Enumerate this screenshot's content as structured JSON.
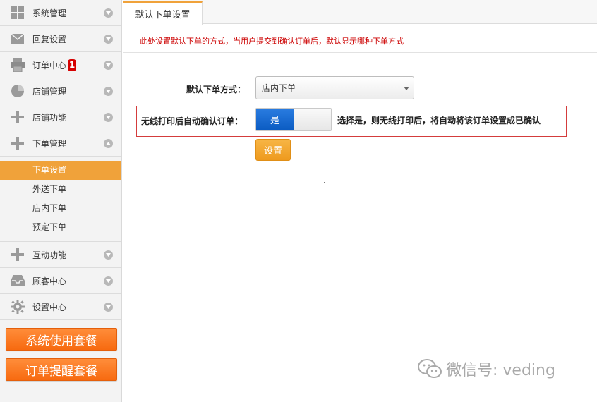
{
  "sidebar": {
    "items": [
      {
        "label": "系统管理",
        "icon": "grid-icon"
      },
      {
        "label": "回复设置",
        "icon": "envelope-icon"
      },
      {
        "label": "订单中心",
        "icon": "printer-icon",
        "badge": "1"
      },
      {
        "label": "店铺管理",
        "icon": "pie-chart-icon"
      },
      {
        "label": "店铺功能",
        "icon": "plus-icon"
      },
      {
        "label": "下单管理",
        "icon": "plus-icon",
        "expanded": true
      }
    ],
    "submenu": [
      {
        "label": "下单设置",
        "active": true
      },
      {
        "label": "外送下单"
      },
      {
        "label": "店内下单"
      },
      {
        "label": "预定下单"
      }
    ],
    "items_after": [
      {
        "label": "互动功能",
        "icon": "plus-icon"
      },
      {
        "label": "顾客中心",
        "icon": "inbox-icon"
      },
      {
        "label": "设置中心",
        "icon": "gear-icon"
      }
    ],
    "buttons": {
      "system_plan": "系统使用套餐",
      "order_alert_plan": "订单提醒套餐"
    }
  },
  "main": {
    "tab_label": "默认下单设置",
    "notice": "此处设置默认下单的方式，当用户提交到确认订单后，默认显示哪种下单方式",
    "order_mode_label": "默认下单方式：",
    "order_mode_value": "店内下单",
    "auto_confirm_label": "无线打印后自动确认订单：",
    "toggle_on_label": "是",
    "auto_confirm_hint": "选择是，则无线打印后，将自动将该订单设置成已确认",
    "save_label": "设置"
  },
  "watermark": {
    "text": "微信号: veding"
  },
  "colors": {
    "accent_orange": "#f0a23a",
    "button_orange": "#f76a10",
    "toggle_blue": "#0b5bc2",
    "notice_red": "#cc0000"
  }
}
